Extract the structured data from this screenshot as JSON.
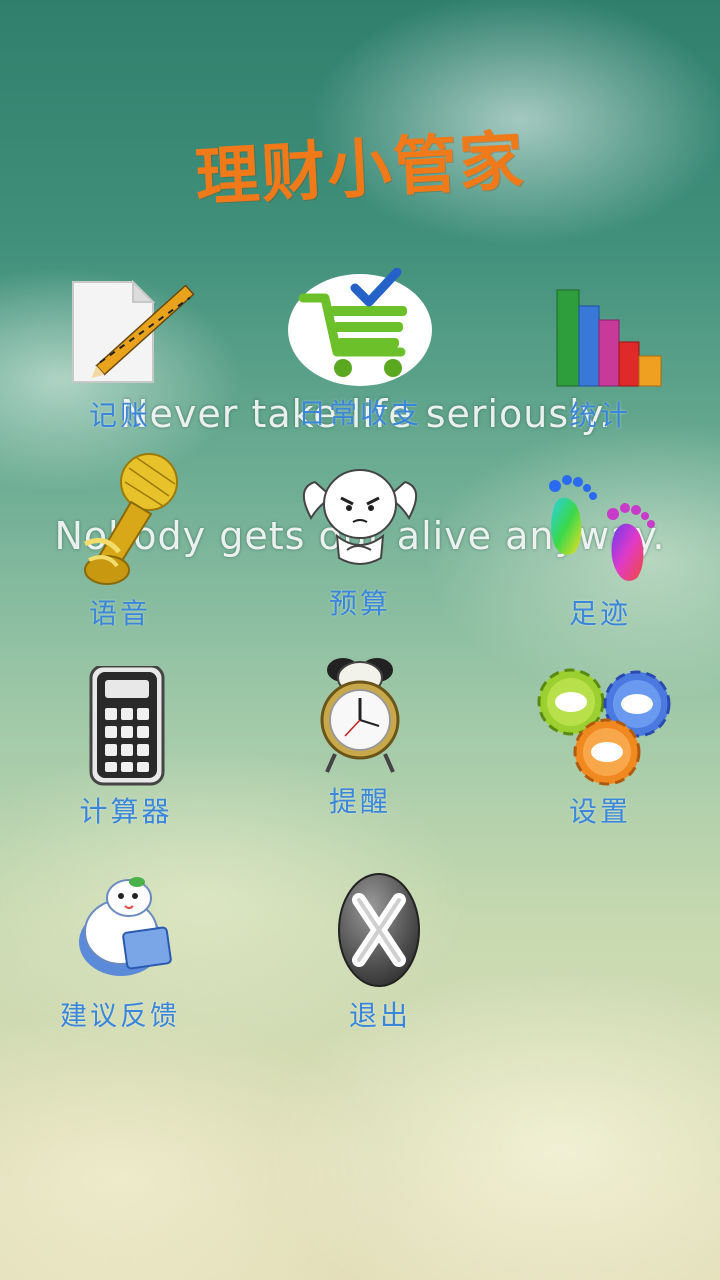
{
  "app": {
    "title": "理财小管家"
  },
  "wallpaper_quote": {
    "line1": "Never take life seriously.",
    "line2": "Nobody gets out alive anyway."
  },
  "menu": {
    "items": [
      {
        "label": "记账",
        "icon": "notepad-pencil-icon"
      },
      {
        "label": "日常收支",
        "icon": "shopping-cart-icon"
      },
      {
        "label": "统计",
        "icon": "bar-chart-icon"
      },
      {
        "label": "语音",
        "icon": "microphone-icon"
      },
      {
        "label": "预算",
        "icon": "cartoon-face-icon"
      },
      {
        "label": "足迹",
        "icon": "footprints-icon"
      },
      {
        "label": "计算器",
        "icon": "calculator-icon"
      },
      {
        "label": "提醒",
        "icon": "alarm-clock-icon"
      },
      {
        "label": "设置",
        "icon": "gears-icon"
      },
      {
        "label": "建议反馈",
        "icon": "feedback-character-icon"
      },
      {
        "label": "退出",
        "icon": "exit-x-icon"
      }
    ]
  },
  "colors": {
    "title": "#f07a1a",
    "label": "#3a86d8"
  }
}
